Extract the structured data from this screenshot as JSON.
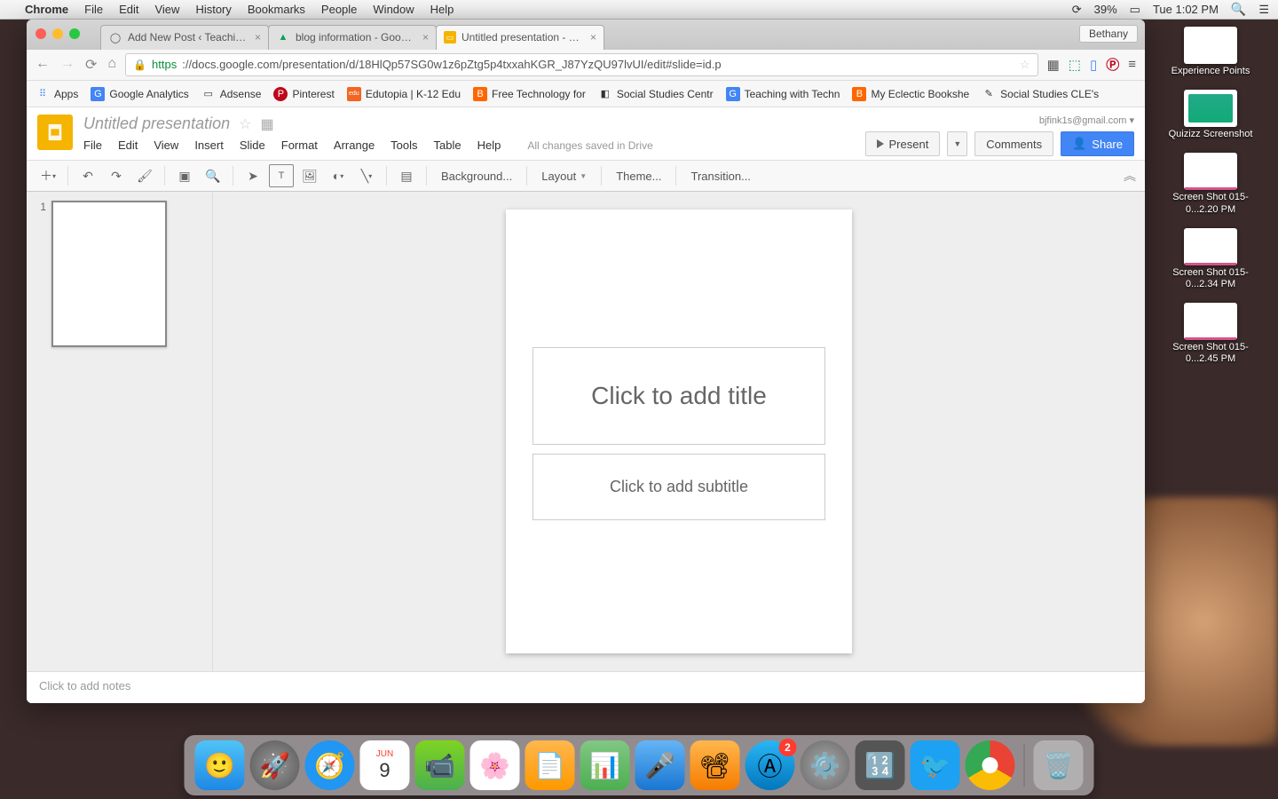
{
  "mac": {
    "app": "Chrome",
    "menus": [
      "File",
      "Edit",
      "View",
      "History",
      "Bookmarks",
      "People",
      "Window",
      "Help"
    ],
    "battery": "39%",
    "clock": "Tue 1:02 PM"
  },
  "chrome": {
    "profile": "Bethany",
    "tabs": [
      {
        "label": "Add New Post ‹ Teaching w",
        "active": false,
        "icon": "wp"
      },
      {
        "label": "blog information - Google D",
        "active": false,
        "icon": "drive"
      },
      {
        "label": "Untitled presentation - Goo",
        "active": true,
        "icon": "slides"
      }
    ],
    "url_proto": "https",
    "url": "://docs.google.com/presentation/d/18HlQp57SG0w1z6pZtg5p4txxahKGR_J87YzQU97lvUI/edit#slide=id.p",
    "bookmarks": [
      {
        "label": "Apps",
        "ico": "⠿",
        "color": "#4285f4"
      },
      {
        "label": "Google Analytics",
        "ico": "G",
        "bg": "#4285f4",
        "fg": "#fff"
      },
      {
        "label": "Adsense",
        "ico": "▭",
        "bg": "#eee"
      },
      {
        "label": "Pinterest",
        "ico": "P",
        "bg": "#bd081c",
        "fg": "#fff"
      },
      {
        "label": "Edutopia | K-12 Edu",
        "ico": "edu",
        "bg": "#f26522",
        "fg": "#fff"
      },
      {
        "label": "Free Technology for",
        "ico": "B",
        "bg": "#ff6600",
        "fg": "#fff"
      },
      {
        "label": "Social Studies Centr",
        "ico": "◧",
        "bg": "#eee"
      },
      {
        "label": "Teaching with Techn",
        "ico": "G",
        "bg": "#4285f4",
        "fg": "#fff"
      },
      {
        "label": "My Eclectic Bookshe",
        "ico": "B",
        "bg": "#ff6600",
        "fg": "#fff"
      },
      {
        "label": "Social Studies CLE's",
        "ico": "✎",
        "bg": "#eee"
      }
    ]
  },
  "slides": {
    "doc_title": "Untitled presentation",
    "email": "bjfink1s@gmail.com",
    "menus": [
      "File",
      "Edit",
      "View",
      "Insert",
      "Slide",
      "Format",
      "Arrange",
      "Tools",
      "Table",
      "Help"
    ],
    "status": "All changes saved in Drive",
    "buttons": {
      "present": "Present",
      "comments": "Comments",
      "share": "Share"
    },
    "toolbar": {
      "bg": "Background...",
      "layout": "Layout",
      "theme": "Theme...",
      "transition": "Transition..."
    },
    "thumb_num": "1",
    "placeholders": {
      "title": "Click to add title",
      "subtitle": "Click to add subtitle"
    },
    "notes": "Click to add notes"
  },
  "desktop": [
    {
      "label": "Experience Points",
      "kind": "plain"
    },
    {
      "label": "Quizizz Screenshot",
      "kind": "green"
    },
    {
      "label": "Screen Shot 015-0...2.20 PM",
      "kind": "pink"
    },
    {
      "label": "Screen Shot 015-0...2.34 PM",
      "kind": "pink"
    },
    {
      "label": "Screen Shot 015-0...2.45 PM",
      "kind": "pink"
    }
  ],
  "dock": {
    "cal_month": "JUN",
    "cal_day": "9",
    "appstore_badge": "2"
  }
}
